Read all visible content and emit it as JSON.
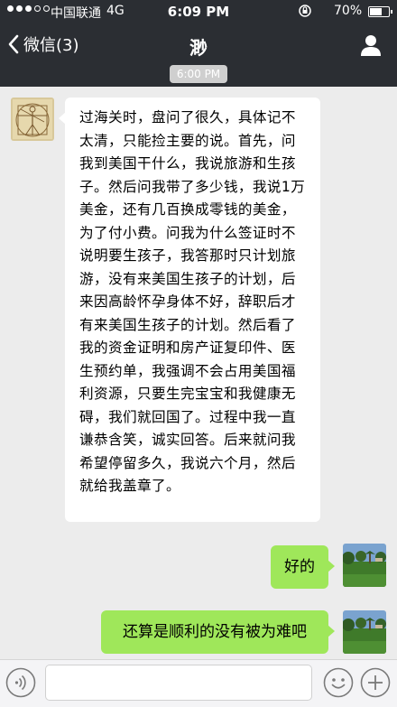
{
  "status_bar": {
    "carrier": "中国联通",
    "network": "4G",
    "time": "6:09 PM",
    "battery_percent": "70%",
    "battery_level": 0.7,
    "signal_strength": 3,
    "signal_max": 5
  },
  "nav": {
    "back_label": "微信(3)",
    "title": "渺"
  },
  "chat": {
    "timestamp": "6:00 PM",
    "messages": [
      {
        "sender": "other",
        "text": "过海关时，盘问了很久，具体记不太清，只能捡主要的说。首先，问我到美国干什么，我说旅游和生孩子。然后问我带了多少钱，我说1万美金，还有几百换成零钱的美金，为了付小费。问我为什么签证时不说明要生孩子，我答那时只计划旅游，没有来美国生孩子的计划，后来因高龄怀孕身体不好，辞职后才有来美国生孩子的计划。然后看了我的资金证明和房产证复印件、医生预约单，我强调不会占用美国福利资源，只要生完宝宝和我健康无碍，我们就回国了。过程中我一直谦恭含笑，诚实回答。后来就问我希望停留多久，我说六个月，然后就给我盖章了。"
      },
      {
        "sender": "me",
        "text": "好的"
      },
      {
        "sender": "me",
        "text": "还算是顺利的没有被为难吧"
      }
    ]
  },
  "colors": {
    "topbar": "#2b2e33",
    "background": "#ececec",
    "incoming_bubble": "#ffffff",
    "outgoing_bubble": "#9fe75a"
  },
  "icons": {
    "back": "chevron-left-icon",
    "profile": "person-icon",
    "voice": "voice-icon",
    "emoji": "smiley-icon",
    "more": "plus-icon"
  }
}
